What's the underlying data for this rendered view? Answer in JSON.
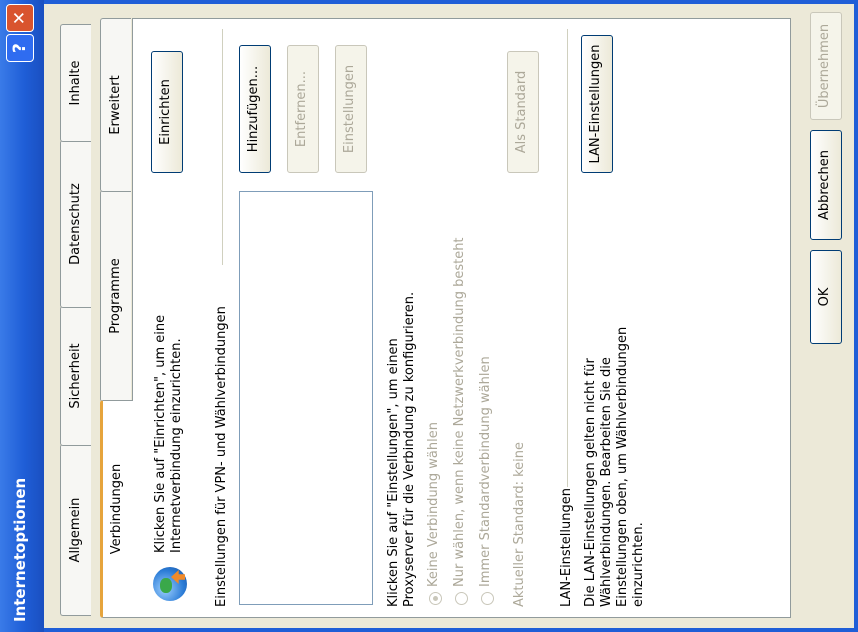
{
  "window": {
    "title": "Internetoptionen",
    "help_label": "?",
    "close_label": "✕"
  },
  "tabs": [
    {
      "label": "Allgemein"
    },
    {
      "label": "Sicherheit"
    },
    {
      "label": "Datenschutz"
    },
    {
      "label": "Inhalte"
    },
    {
      "label": "Verbindungen",
      "selected": true
    },
    {
      "label": "Programme"
    },
    {
      "label": "Erweitert"
    }
  ],
  "connections": {
    "setup_text": [
      "Klicken Sie auf \"Einrichten\", um eine",
      "Internetverbindung einzurichten."
    ],
    "setup_button": "Einrichten",
    "vpn_group_label": "Einstellungen für VPN- und Wählverbindungen",
    "add_button": "Hinzufügen...",
    "remove_button": "Entfernen...",
    "settings_button": "Einstellungen",
    "proxy_text": [
      "Klicken Sie auf \"Einstellungen\", um einen",
      "Proxyserver für die Verbindung zu konfigurieren."
    ],
    "options": [
      {
        "label": "Keine Verbindung wählen",
        "checked": true,
        "enabled": false
      },
      {
        "label": "Nur wählen, wenn keine Netzwerkverbindung besteht",
        "checked": false,
        "enabled": false
      },
      {
        "label": "Immer Standardverbindung wählen",
        "checked": false,
        "enabled": false
      }
    ],
    "current_default": "Aktueller Standard:   keine",
    "as_default_button": "Als Standard",
    "lan_group_label": "LAN-Einstellungen",
    "lan_text": [
      "Die LAN-Einstellungen gelten nicht für",
      "Wählverbindungen. Bearbeiten Sie die",
      "Einstellungen oben, um Wählverbindungen",
      "einzurichten."
    ],
    "lan_button": "LAN-Einstellungen"
  },
  "footer": {
    "ok": "OK",
    "cancel": "Abbrechen",
    "apply": "Übernehmen"
  }
}
